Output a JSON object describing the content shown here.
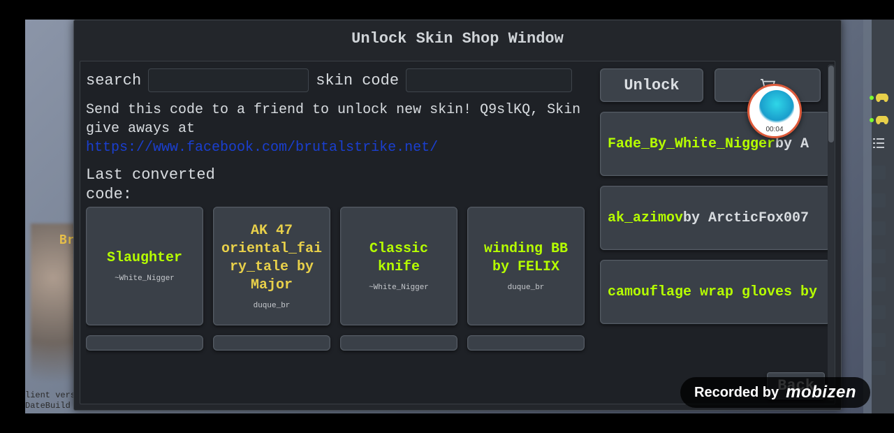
{
  "window": {
    "title": "Unlock Skin Shop Window"
  },
  "inputs": {
    "search_label": "search",
    "search_value": "",
    "code_label": "skin code",
    "code_value": ""
  },
  "info": {
    "line": "Send this code to a friend to unlock new skin! Q9slKQ, Skin give aways at",
    "link": "https://www.facebook.com/brutalstrike.net/"
  },
  "last_converted_label": "Last converted code:",
  "cards": [
    {
      "title": "Slaughter",
      "color": "green",
      "sub": "~White_Nigger"
    },
    {
      "title": "AK 47 oriental_fairy_tale by Major",
      "color": "yellow",
      "sub": "duque_br"
    },
    {
      "title": "Classic knife",
      "color": "green",
      "sub": "~White_Nigger"
    },
    {
      "title": "winding BB by FELIX",
      "color": "green",
      "sub": "duque_br"
    }
  ],
  "right_buttons": {
    "unlock": "Unlock",
    "cart_icon": "cart-icon"
  },
  "side_list": [
    {
      "name": "Fade_By_White_Nigger",
      "by": " by A"
    },
    {
      "name": "ak_azimov",
      "by": " by ArcticFox007"
    },
    {
      "name": "camouflage wrap gloves by",
      "by": ""
    }
  ],
  "back_label": "Back",
  "recorder": {
    "time": "00:04",
    "watermark_prefix": "Recorded by",
    "watermark_brand": "mobizen"
  },
  "background": {
    "partial_text": "Br",
    "corner_line1": "lient vers",
    "corner_line2": "DateBuild"
  }
}
